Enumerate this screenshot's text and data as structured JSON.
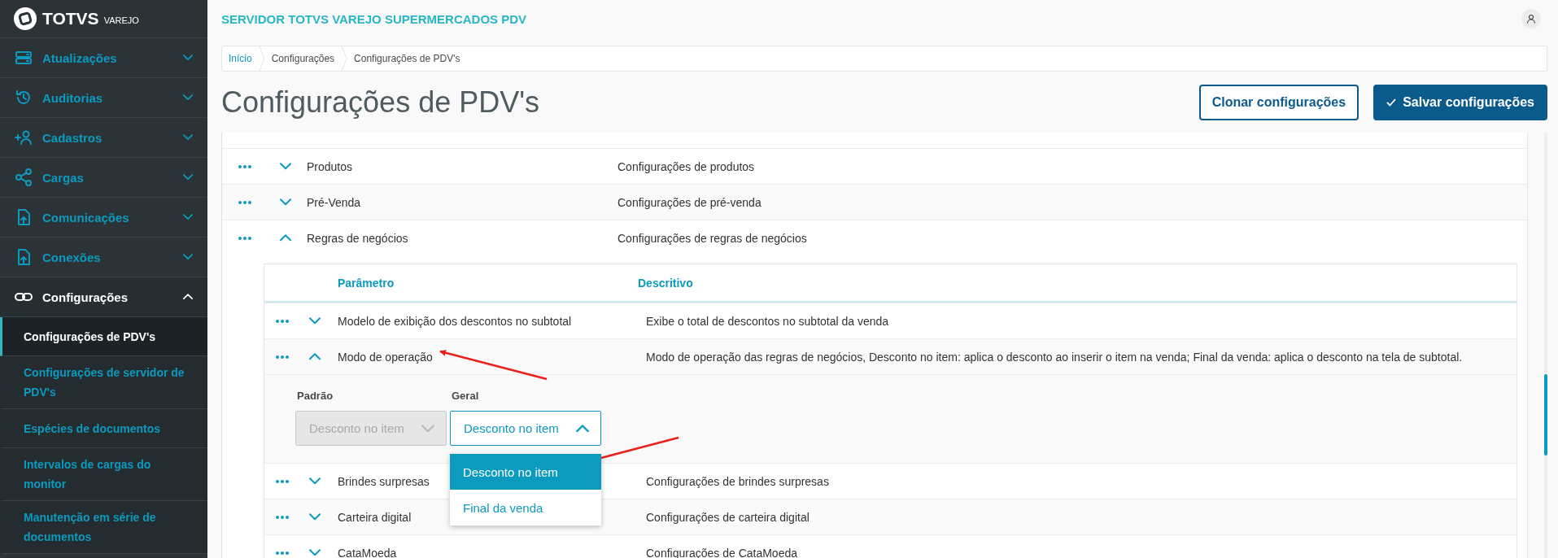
{
  "sidebar": {
    "logo": {
      "brand": "TOTVS",
      "product": "VAREJO"
    },
    "items": [
      {
        "label": "Atualizações",
        "expanded": false
      },
      {
        "label": "Auditorias",
        "expanded": false
      },
      {
        "label": "Cadastros",
        "expanded": false
      },
      {
        "label": "Cargas",
        "expanded": false
      },
      {
        "label": "Comunicações",
        "expanded": false
      },
      {
        "label": "Conexões",
        "expanded": false
      },
      {
        "label": "Configurações",
        "expanded": true,
        "children": [
          {
            "label": "Configurações de PDV's",
            "selected": true
          },
          {
            "label": "Configurações de servidor de PDV's",
            "selected": false
          },
          {
            "label": "Espécies de documentos",
            "selected": false
          },
          {
            "label": "Intervalos de cargas do monitor",
            "selected": false
          },
          {
            "label": "Manutenção em série de documentos",
            "selected": false
          }
        ]
      }
    ]
  },
  "header": {
    "title": "SERVIDOR TOTVS VAREJO SUPERMERCADOS PDV"
  },
  "breadcrumb": [
    {
      "label": "Início",
      "link": true
    },
    {
      "label": "Configurações",
      "link": false
    },
    {
      "label": "Configurações de PDV's",
      "link": false
    }
  ],
  "page_title": "Configurações de PDV's",
  "buttons": [
    {
      "label": "Clonar configurações",
      "kind": "secondary"
    },
    {
      "label": "Salvar configurações",
      "kind": "primary"
    }
  ],
  "table": {
    "rows": [
      {
        "name": "Produtos",
        "description": "Configurações de produtos",
        "expanded": false
      },
      {
        "name": "Pré-Venda",
        "description": "Configurações de pré-venda",
        "expanded": false
      },
      {
        "name": "Regras de negócios",
        "description": "Configurações de regras de negócios",
        "expanded": true,
        "detail": {
          "columns": [
            "Parâmetro",
            "Descritivo"
          ],
          "rows": [
            {
              "name": "Modelo de exibição dos descontos no subtotal",
              "description": "Exibe o total de descontos no subtotal da venda",
              "expanded": false
            },
            {
              "name": "Modo de operação",
              "description": "Modo de operação das regras de negócios, Desconto no item: aplica o desconto ao inserir o item na venda; Final da venda: aplica o desconto na tela de subtotal.",
              "expanded": true,
              "fields": [
                {
                  "label": "Padrão",
                  "value": "Desconto no item",
                  "disabled": true,
                  "open": false
                },
                {
                  "label": "Geral",
                  "value": "Desconto no item",
                  "disabled": false,
                  "open": true,
                  "options": [
                    {
                      "label": "Desconto no item",
                      "selected": true
                    },
                    {
                      "label": "Final da venda",
                      "selected": false
                    }
                  ]
                }
              ]
            },
            {
              "name": "Brindes surpresas",
              "description": "Configurações de brindes surpresas",
              "expanded": false
            },
            {
              "name": "Carteira digital",
              "description": "Configurações de carteira digital",
              "expanded": false
            },
            {
              "name": "CataMoeda",
              "description": "Configurações de CataMoeda",
              "expanded": false
            }
          ]
        }
      }
    ]
  }
}
